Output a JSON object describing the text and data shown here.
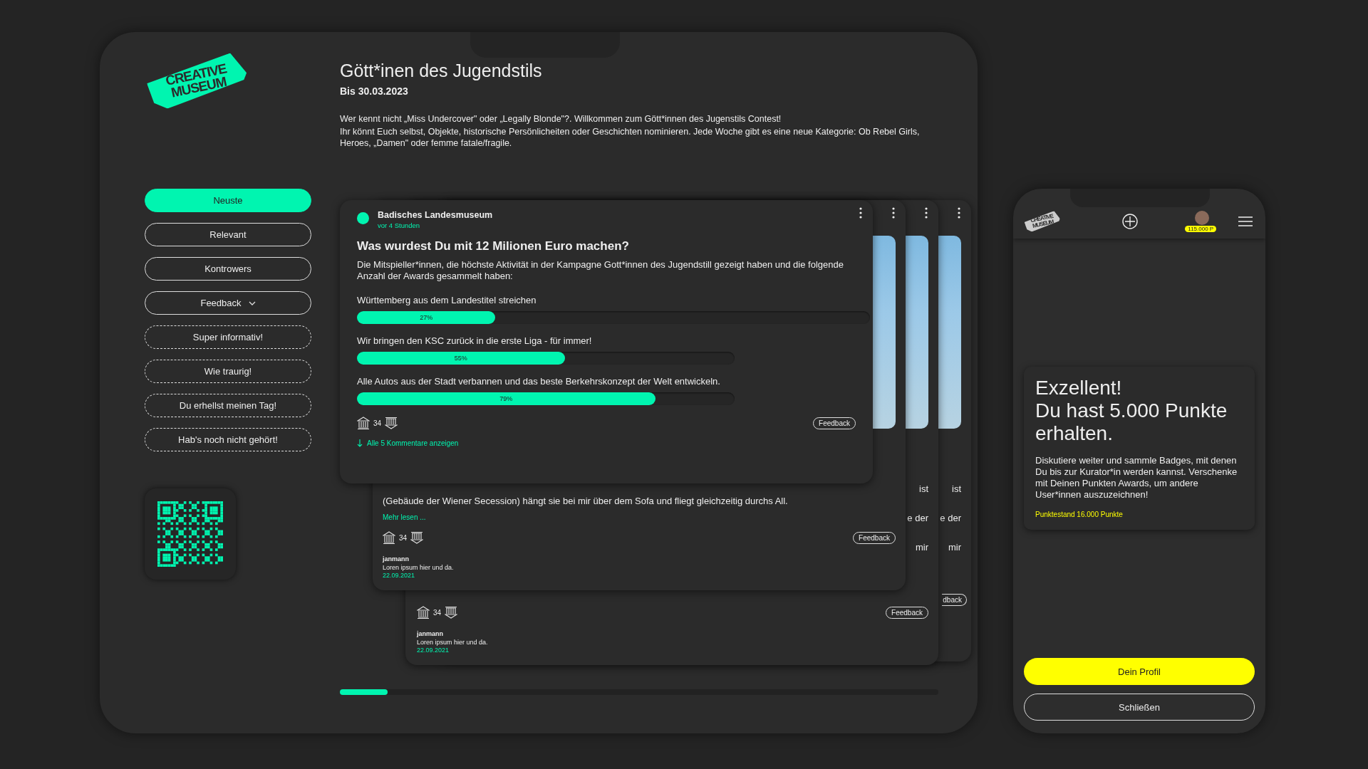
{
  "brand": {
    "logo_top": "CREATIVE",
    "logo_bottom": "MUSEUM"
  },
  "campaign": {
    "title": "Gött*inen des  Jugendstils",
    "date": "Bis 30.03.2023",
    "intro": "Wer kennt nicht „Miss Undercover\" oder „Legally Blonde\"?. Willkommen zum  Gött*innen des Jugenstils Contest!",
    "description": "Ihr könnt Euch selbst, Objekte, historische Persönlicheiten oder Geschichten nominieren. Jede Woche gibt es eine neue  Kategorie: Ob Rebel Girls, Heroes, „Damen\" oder femme fatale/fragile."
  },
  "filters": [
    {
      "label": "Neuste",
      "kind": "sort",
      "selected": true
    },
    {
      "label": "Relevant",
      "kind": "sort",
      "selected": false
    },
    {
      "label": "Kontrowers",
      "kind": "sort",
      "selected": false
    },
    {
      "label": "Feedback",
      "kind": "dropdown",
      "selected": false,
      "expanded": true
    },
    {
      "label": "Super informativ!",
      "kind": "option",
      "selected": false
    },
    {
      "label": "Wie traurig!",
      "kind": "option",
      "selected": false
    },
    {
      "label": "Du erhellst meinen Tag!",
      "kind": "option",
      "selected": false
    },
    {
      "label": "Hab's noch nicht gehört!",
      "kind": "option",
      "selected": false
    }
  ],
  "post": {
    "author": "Badisches Landesmuseum",
    "time": "vor 4 Stunden",
    "question": "Was wurdest Du mit 12 Milionen Euro machen?",
    "text": "Die Mitspieller*innen, die höchste Aktivität in der Kampagne Gott*innen des Jugendstill gezeigt haben und die folgende Anzahl der Awards gesammelt haben:",
    "options": [
      {
        "label": "Württemberg aus dem Landestitel streichen",
        "reading": "27%",
        "level": 0.27
      },
      {
        "label": "Wir bringen den KSC zurück in die erste Liga - für immer!",
        "reading": "55%",
        "level": 0.55
      },
      {
        "label": "Alle Autos aus der Stadt verbannen und das beste Berkehrskonzept der Welt entwickeln.",
        "reading": "79%",
        "level": 0.79
      }
    ],
    "count": "34",
    "feedback": "Feedback",
    "comments_link": "Alle 5 Kommentare anzeigen"
  },
  "back_cards": [
    {
      "kind": "full",
      "text": "(Gebäude der Wiener Secession) hängt sie bei mir über dem Sofa und fliegt gleichzeitig durchs All.",
      "more": "Mehr lesen ...",
      "count": "34",
      "feedback": "Feedback",
      "comment": {
        "author": "janmann",
        "text": "Loren ipsum hier und da.",
        "date": "22.09.2021"
      }
    },
    {
      "kind": "full",
      "fragments": [
        "ist",
        "e der",
        "mir"
      ],
      "count": "34",
      "feedback": "Feedback",
      "comment": {
        "author": "janmann",
        "text": "Loren ipsum hier und da.",
        "date": "22.09.2021"
      }
    },
    {
      "kind": "edge",
      "fragments": [
        "ist",
        "e der",
        "mir"
      ],
      "feedback": "dback"
    }
  ],
  "pager": {
    "level": 0.08
  },
  "phone": {
    "logo_top": "CREATIVE",
    "logo_bottom": "MUSEUM",
    "points_badge": "115.000 P",
    "title_lines": [
      "Exzellent!",
      "Du hast  5.000 Punkte erhalten."
    ],
    "text": "Diskutiere weiter und sammle Badges, mit denen Du bis zur Kurator*in werden kannst. Verschenke mit Deinen Punkten Awards, um andere User*innen auszuzeichnen!",
    "balance": "Punktestand 16.000 Punkte",
    "primary": "Dein Profil",
    "secondary": "Schließen"
  }
}
